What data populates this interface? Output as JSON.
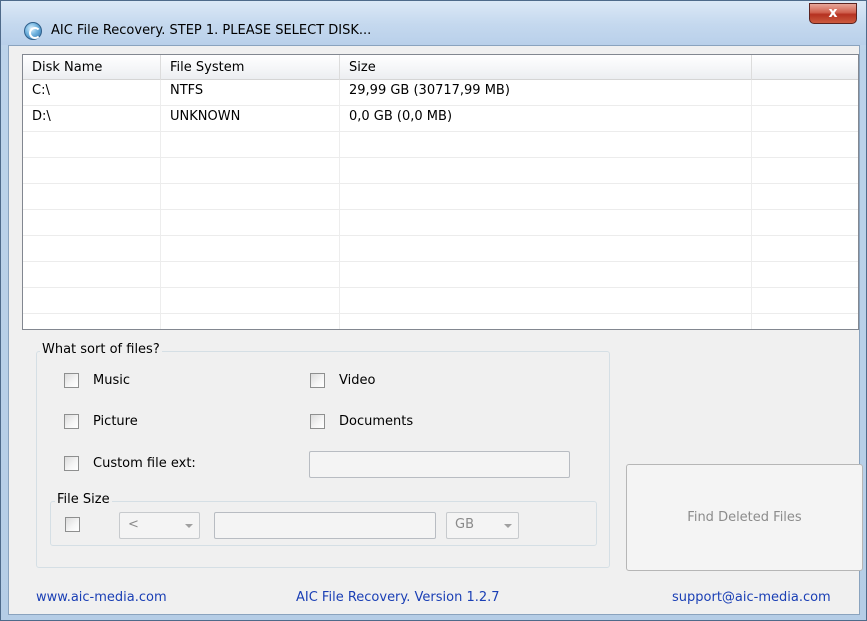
{
  "window": {
    "title": "AIC File Recovery. STEP 1. PLEASE SELECT DISK...",
    "close_symbol": "x",
    "icon": "app-disc-icon"
  },
  "disk_list": {
    "columns": [
      "Disk Name",
      "File System",
      "Size"
    ],
    "rows": [
      {
        "disk_name": "C:\\",
        "file_system": "NTFS",
        "size": "29,99 GB (30717,99 MB)"
      },
      {
        "disk_name": "D:\\",
        "file_system": "UNKNOWN",
        "size": "0,0 GB (0,0 MB)"
      }
    ]
  },
  "file_types": {
    "legend": "What sort of files?",
    "music": "Music",
    "video": "Video",
    "picture": "Picture",
    "documents": "Documents",
    "custom_ext": "Custom file ext:"
  },
  "file_size": {
    "legend": "File Size",
    "operator": "<",
    "unit": "GB"
  },
  "find_button": "Find Deleted Files",
  "footer": {
    "website": "www.aic-media.com",
    "version": "AIC File Recovery. Version 1.2.7",
    "support": "support@aic-media.com"
  }
}
